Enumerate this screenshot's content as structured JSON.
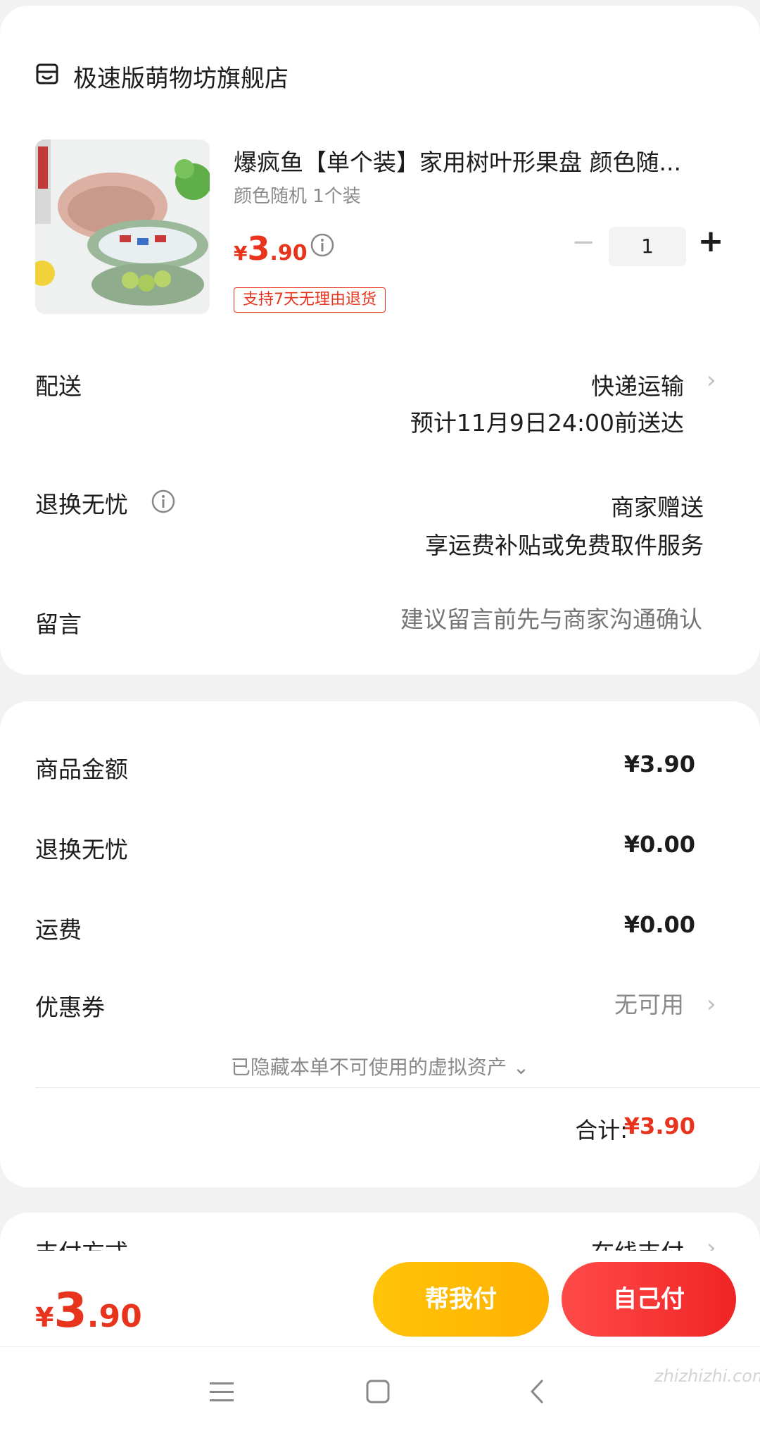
{
  "store": {
    "name": "极速版萌物坊旗舰店",
    "icon": "store-icon"
  },
  "product": {
    "title": "爆疯鱼【单个装】家用树叶形果盘 颜色随...",
    "spec": "颜色随机 1个装",
    "price_currency": "¥",
    "price_int": "3",
    "price_dec": ".90",
    "quantity": "1",
    "minus_label": "−",
    "plus_label": "+",
    "return_badge": "支持7天无理由退货"
  },
  "delivery": {
    "label": "配送",
    "method": "快递运输",
    "eta": "预计11月9日24:00前送达"
  },
  "after_sale": {
    "label": "退换无忧",
    "value": "商家赠送",
    "desc": "享运费补贴或免费取件服务"
  },
  "message": {
    "label": "留言",
    "placeholder": "建议留言前先与商家沟通确认"
  },
  "summary": {
    "goods_label": "商品金额",
    "goods_value": "¥3.90",
    "after_label": "退换无忧",
    "after_value": "¥0.00",
    "shipping_label": "运费",
    "shipping_value": "¥0.00",
    "coupon_label": "优惠券",
    "coupon_value": "无可用",
    "hidden_assets": "已隐藏本单不可使用的虚拟资产 ⌄",
    "total_label": "合计:",
    "total_value": "¥3.90"
  },
  "payment": {
    "label": "支付方式",
    "value": "在线支付"
  },
  "bottom_bar": {
    "price_currency": "¥",
    "price_int": "3",
    "price_dec": ".90",
    "help_pay": "帮我付",
    "self_pay": "自己付"
  },
  "chevron": "›",
  "watermark": "zhizhizhi.com",
  "colors": {
    "accent": "#e8341c",
    "help_btn": "#ffbb00",
    "self_btn": "#f23030"
  }
}
